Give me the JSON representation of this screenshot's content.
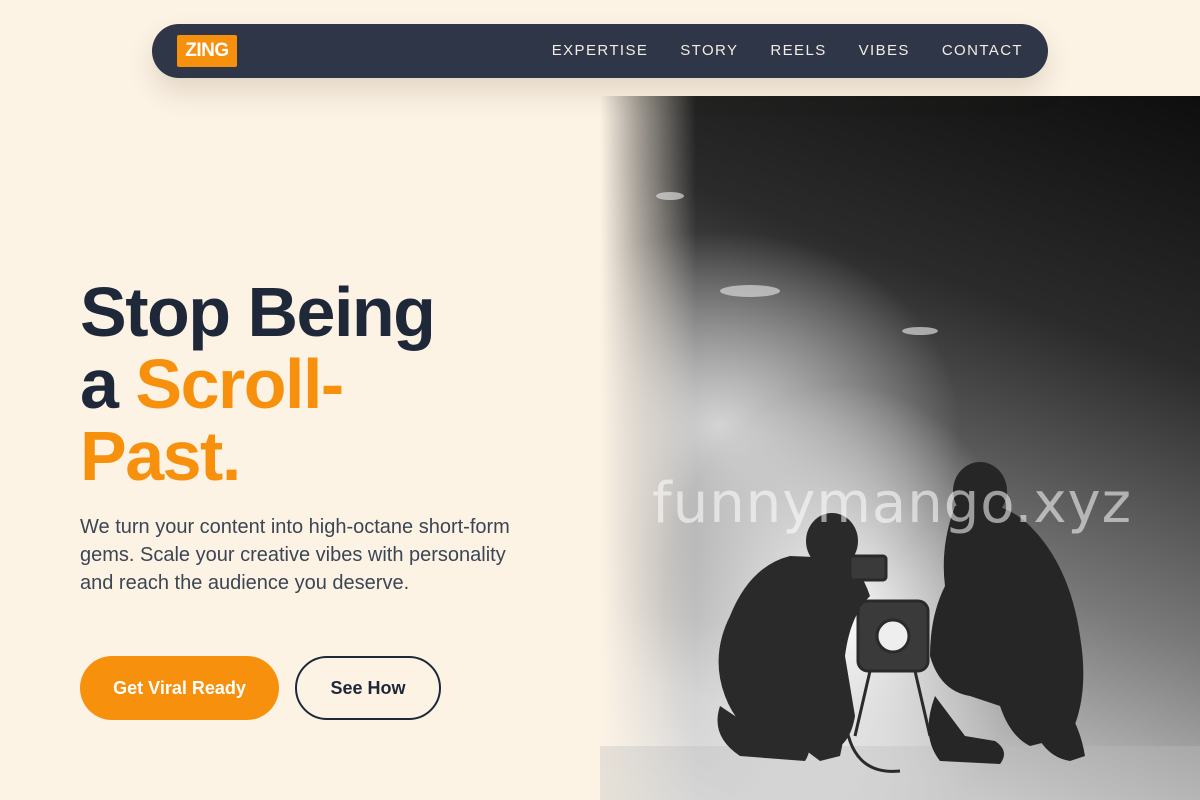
{
  "nav": {
    "logo": "ZING",
    "links": [
      "EXPERTISE",
      "STORY",
      "REELS",
      "VIBES",
      "CONTACT"
    ]
  },
  "hero": {
    "headline_line1": "Stop Being",
    "headline_line2_prefix": "a ",
    "headline_line2_accent": "Scroll-",
    "headline_line3_accent": "Past.",
    "description": "We turn your content into high-octane short-form gems. Scale your creative vibes with personality and reach the audience you deserve.",
    "primary_button": "Get Viral Ready",
    "secondary_button": "See How",
    "image_watermark": "funnymango.xyz"
  },
  "colors": {
    "accent": "#f7900d",
    "dark": "#1f2839",
    "nav_bg": "#2e3647",
    "page_bg": "#fdf3e5"
  }
}
